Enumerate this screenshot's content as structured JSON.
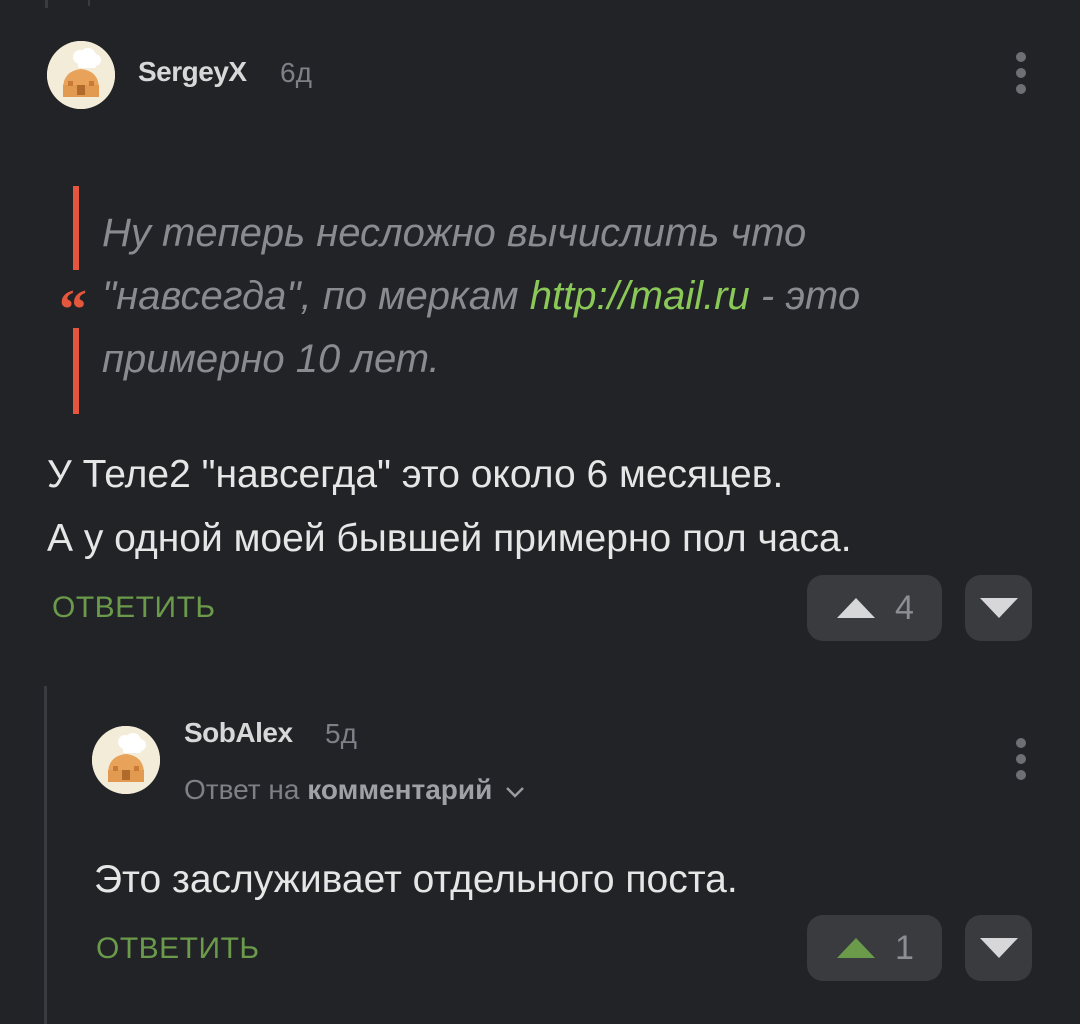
{
  "comments": [
    {
      "username": "SergeyX",
      "time_ago": "6д",
      "quote": {
        "before_link": "Ну теперь несложно вычислить что \"навсегда\", по меркам ",
        "link": "http://mail.ru",
        "after_link": " - это примерно 10 лет."
      },
      "text_line1": "У Теле2 \"навсегда\" это около 6 месяцев.",
      "text_line2": "А у одной моей бывшей примерно пол часа.",
      "reply_label": "ОТВЕТИТЬ",
      "rating": "4"
    },
    {
      "username": "SobAlex",
      "time_ago": "5д",
      "reply_to_prefix": "Ответ на",
      "reply_to_target": "комментарий",
      "text": "Это заслуживает отдельного поста.",
      "reply_label": "ОТВЕТИТЬ",
      "rating": "1"
    }
  ],
  "colors": {
    "background": "#222327",
    "accent_green": "#6a9a4a",
    "quote_bar": "#e5573d",
    "link": "#8ac858",
    "upvoted": "#6a9a4a"
  },
  "icons": {
    "avatar": "chef-hat-house-avatar",
    "menu": "kebab-menu-icon",
    "upvote": "triangle-up-icon",
    "downvote": "triangle-down-icon",
    "expand": "chevron-down-icon",
    "quote": "quote-mark-icon"
  }
}
